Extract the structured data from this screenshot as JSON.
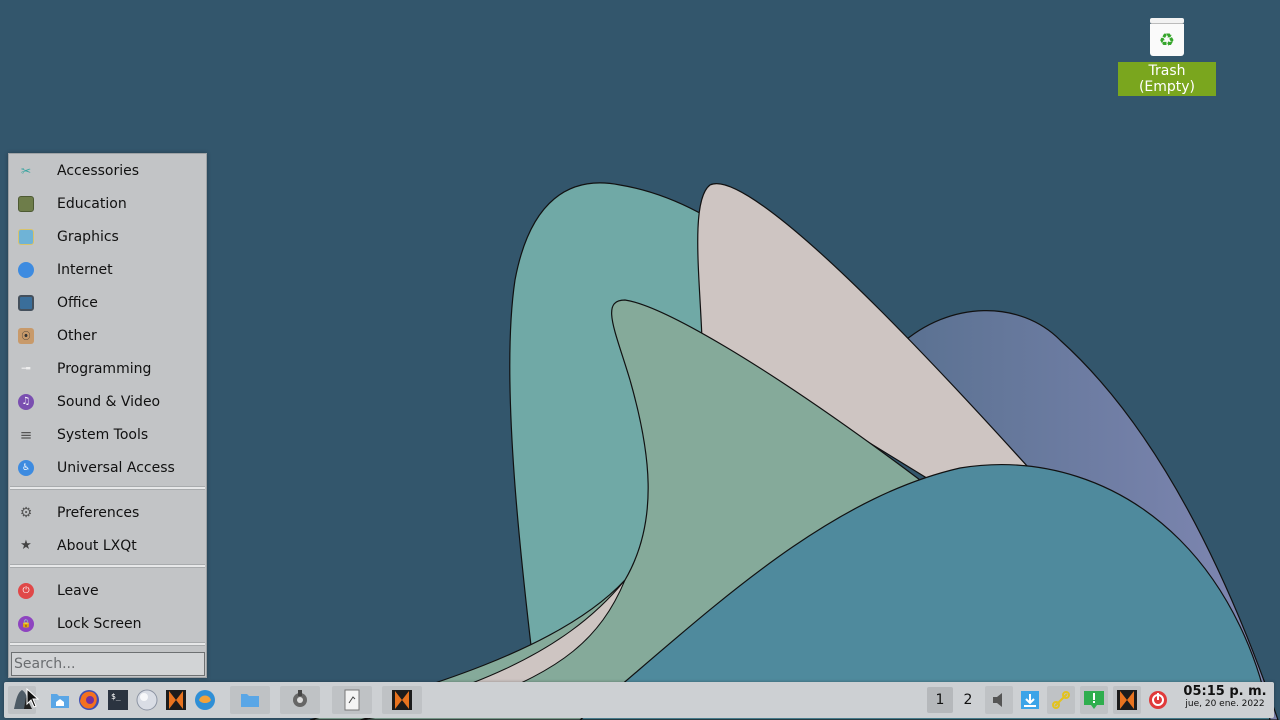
{
  "desktop": {
    "trash_label": "Trash (Empty)"
  },
  "menu": {
    "items": [
      {
        "label": "Accessories",
        "icon": "accessories-icon"
      },
      {
        "label": "Education",
        "icon": "education-icon"
      },
      {
        "label": "Graphics",
        "icon": "graphics-icon"
      },
      {
        "label": "Internet",
        "icon": "internet-icon"
      },
      {
        "label": "Office",
        "icon": "office-icon"
      },
      {
        "label": "Other",
        "icon": "other-icon"
      },
      {
        "label": "Programming",
        "icon": "programming-icon"
      },
      {
        "label": "Sound & Video",
        "icon": "sound-video-icon"
      },
      {
        "label": "System Tools",
        "icon": "system-tools-icon"
      },
      {
        "label": "Universal Access",
        "icon": "universal-access-icon"
      }
    ],
    "settings_items": [
      {
        "label": "Preferences",
        "icon": "preferences-icon"
      },
      {
        "label": "About LXQt",
        "icon": "about-star-icon"
      }
    ],
    "session_items": [
      {
        "label": "Leave",
        "icon": "leave-icon"
      },
      {
        "label": "Lock Screen",
        "icon": "lock-icon"
      }
    ],
    "search_placeholder": "Search..."
  },
  "taskbar": {
    "desktops": [
      "1",
      "2"
    ],
    "clock_time": "05:15 p. m.",
    "clock_date": "jue, 20 ene. 2022"
  },
  "colors": {
    "background": "#33566c",
    "accent_trash_label": "#7aa61e",
    "menu_bg": "#c2c4c6"
  }
}
